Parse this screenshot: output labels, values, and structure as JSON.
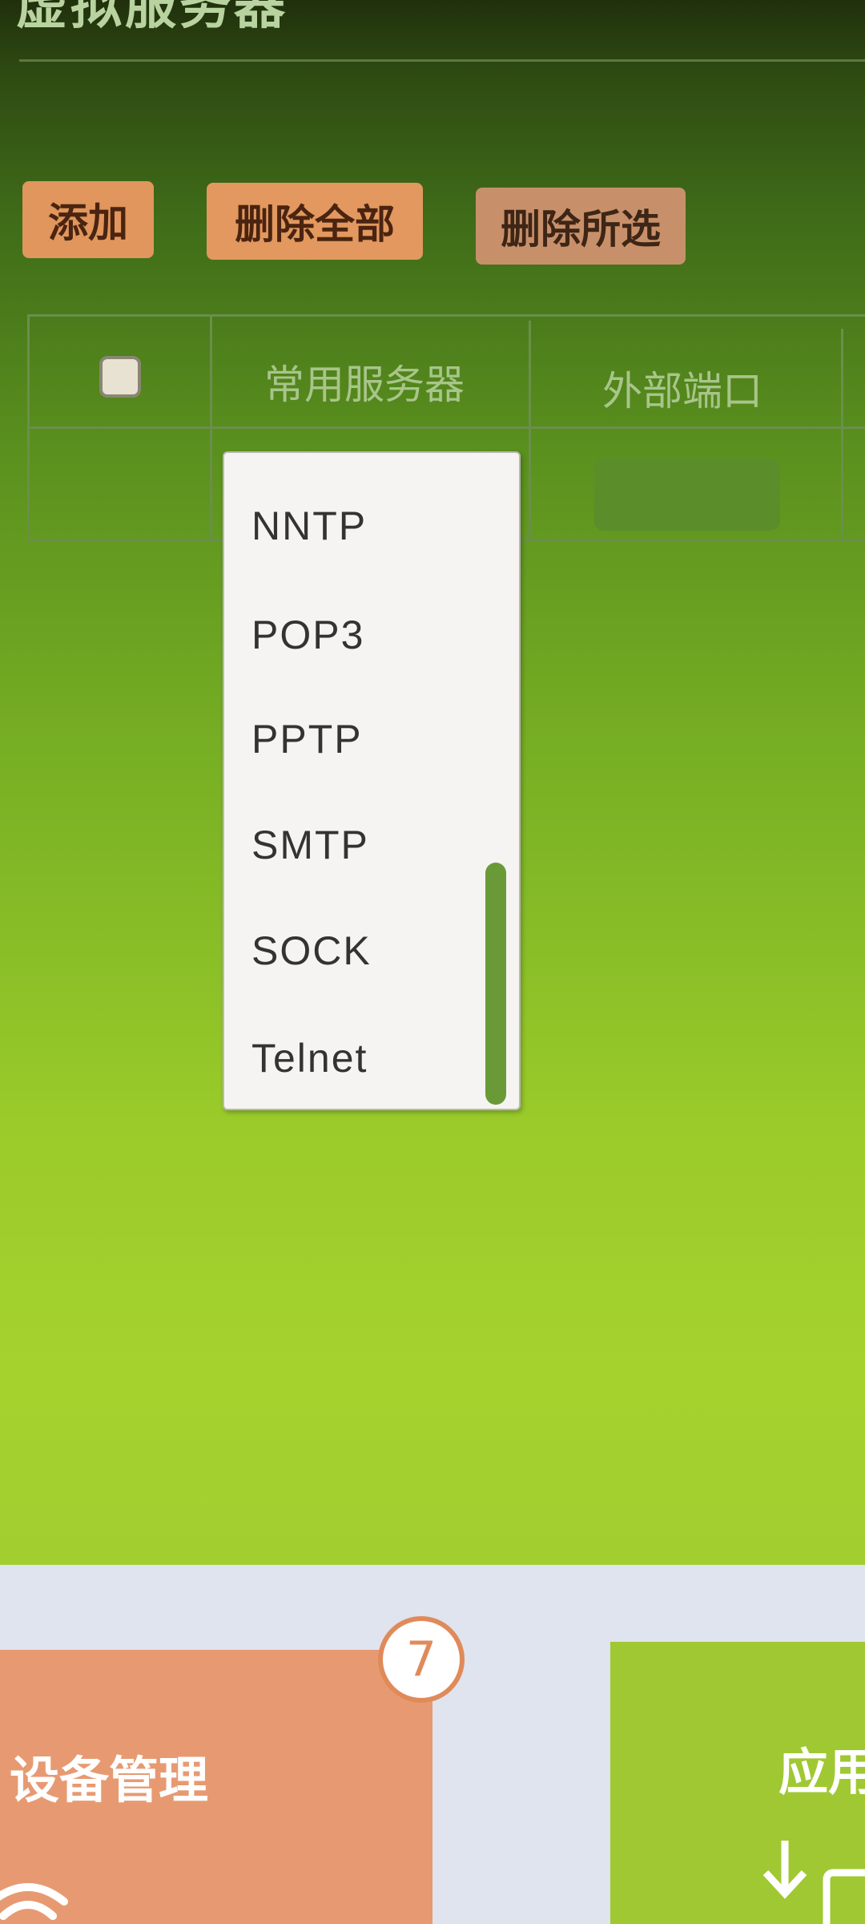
{
  "page": {
    "title": "虚拟服务器"
  },
  "toolbar": {
    "add_label": "添加",
    "delete_all_label": "删除全部",
    "delete_selected_label": "删除所选"
  },
  "table": {
    "headers": [
      "常用服务器",
      "外部端口"
    ]
  },
  "dropdown": {
    "options": [
      "NNTP",
      "POP3",
      "PPTP",
      "SMTP",
      "SOCK",
      "Telnet"
    ]
  },
  "dashboard": {
    "device_management_label": "设备管理",
    "device_badge_count": "7",
    "app_label": "应用"
  },
  "colors": {
    "button_orange": "#e0965c",
    "device_card": "#e79a72",
    "app_card": "#a0c832"
  }
}
